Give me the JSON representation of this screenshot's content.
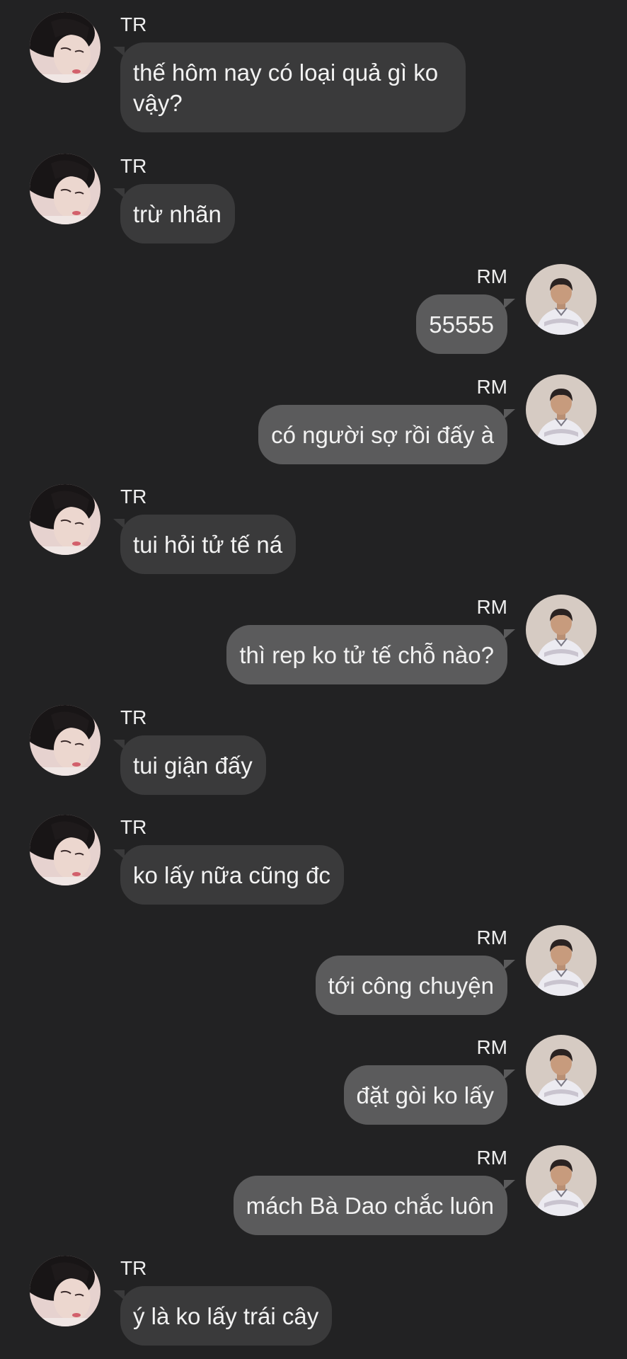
{
  "conversation": {
    "messages": [
      {
        "side": "left",
        "sender": "TR",
        "text": "thế hôm nay có loại quả gì ko vậy?"
      },
      {
        "side": "left",
        "sender": "TR",
        "text": "trừ nhãn"
      },
      {
        "side": "right",
        "sender": "RM",
        "text": "55555"
      },
      {
        "side": "right",
        "sender": "RM",
        "text": "có người sợ rồi đấy à"
      },
      {
        "side": "left",
        "sender": "TR",
        "text": "tui hỏi tử tế ná"
      },
      {
        "side": "right",
        "sender": "RM",
        "text": "thì rep ko tử tế chỗ nào?"
      },
      {
        "side": "left",
        "sender": "TR",
        "text": "tui giận đấy"
      },
      {
        "side": "left",
        "sender": "TR",
        "text": "ko lấy nữa cũng đc"
      },
      {
        "side": "right",
        "sender": "RM",
        "text": "tới công chuyện"
      },
      {
        "side": "right",
        "sender": "RM",
        "text": "đặt gòi ko lấy"
      },
      {
        "side": "right",
        "sender": "RM",
        "text": "mách Bà Dao chắc luôn"
      },
      {
        "side": "left",
        "sender": "TR",
        "text": "ý là ko lấy trái cây"
      }
    ]
  },
  "theme": {
    "background": "#222223",
    "bubble_incoming": "#3a3a3b",
    "bubble_outgoing": "#5b5b5c",
    "text": "#f2f2f2"
  },
  "icons": {
    "tr_avatar": "avatar-photo-tr",
    "rm_avatar": "avatar-photo-rm"
  }
}
